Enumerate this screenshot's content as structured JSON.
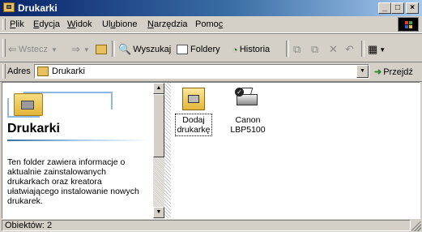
{
  "window": {
    "title": "Drukarki"
  },
  "menu": {
    "items": [
      {
        "label": "Plik",
        "ul": "P",
        "rest": "lik"
      },
      {
        "label": "Edycja",
        "ul": "E",
        "rest": "dycja"
      },
      {
        "label": "Widok",
        "ul": "W",
        "rest": "idok"
      },
      {
        "label": "Ulubione",
        "pre": "Ul",
        "ul": "u",
        "rest": "bione"
      },
      {
        "label": "Narzędzia",
        "ul": "N",
        "rest": "arzędzia"
      },
      {
        "label": "Pomoc",
        "pre": "Pomo",
        "ul": "c",
        "rest": ""
      }
    ]
  },
  "toolbar": {
    "back": "Wstecz",
    "search": "Wyszukaj",
    "folders": "Foldery",
    "history": "Historia"
  },
  "address": {
    "label": "Adres",
    "value": "Drukarki",
    "go": "Przejdź"
  },
  "leftpane": {
    "heading": "Drukarki",
    "description": "Ten folder zawiera informacje o aktualnie zainstalowanych drukarkach oraz kreatora ułatwiającego instalowanie nowych drukarek."
  },
  "files": [
    {
      "line1": "Dodaj",
      "line2": "drukarkę"
    },
    {
      "line1": "Canon",
      "line2": "LBP5100"
    }
  ],
  "status": {
    "text": "Obiektów: 2"
  }
}
